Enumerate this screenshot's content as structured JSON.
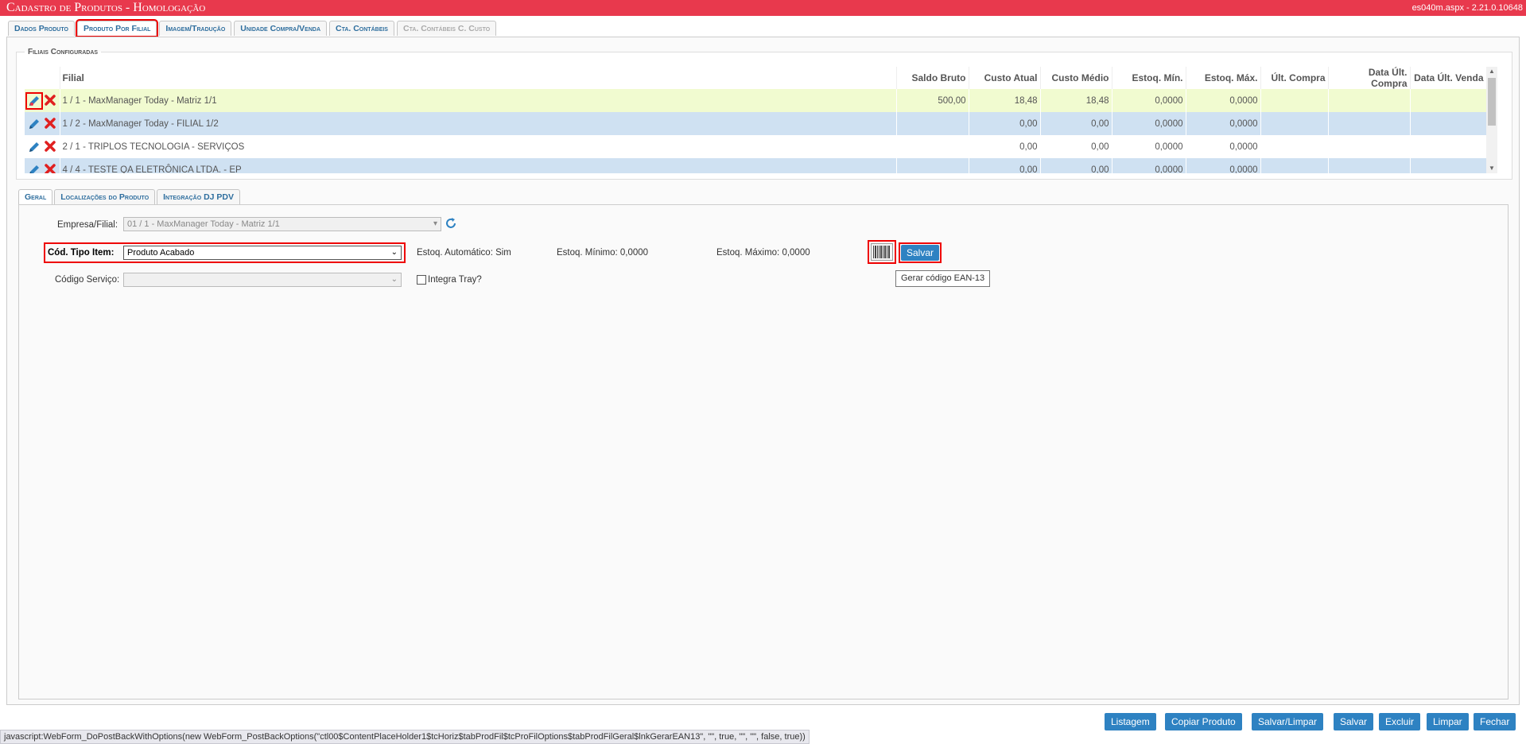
{
  "title": "Cadastro de Produtos  - Homologação",
  "version": "es040m.aspx - 2.21.0.10648",
  "main_tabs": [
    {
      "label": "Dados Produto"
    },
    {
      "label": "Produto Por Filial"
    },
    {
      "label": "Imagem/Tradução"
    },
    {
      "label": "Unidade Compra/Venda"
    },
    {
      "label": "Cta. Contábeis"
    },
    {
      "label": "Cta. Contábeis C. Custo"
    }
  ],
  "filiais": {
    "legend": "Filiais Configuradas",
    "columns": [
      "Filial",
      "Saldo Bruto",
      "Custo Atual",
      "Custo Médio",
      "Estoq. Mín.",
      "Estoq. Máx.",
      "Últ. Compra",
      "Data Últ. Compra",
      "Data Últ. Venda"
    ],
    "rows": [
      {
        "filial": "1 / 1 - MaxManager Today - Matriz 1/1",
        "saldo": "500,00",
        "custo_atual": "18,48",
        "custo_medio": "18,48",
        "min": "0,0000",
        "max": "0,0000",
        "ult_compra": "",
        "data_compra": "",
        "data_venda": ""
      },
      {
        "filial": "1 / 2 - MaxManager Today - FILIAL 1/2",
        "saldo": "",
        "custo_atual": "0,00",
        "custo_medio": "0,00",
        "min": "0,0000",
        "max": "0,0000",
        "ult_compra": "",
        "data_compra": "",
        "data_venda": ""
      },
      {
        "filial": "2 / 1 - TRIPLOS TECNOLOGIA - SERVIÇOS",
        "saldo": "",
        "custo_atual": "0,00",
        "custo_medio": "0,00",
        "min": "0,0000",
        "max": "0,0000",
        "ult_compra": "",
        "data_compra": "",
        "data_venda": ""
      },
      {
        "filial": "4 / 4 - TESTE QA ELETRÔNICA LTDA. - EP",
        "saldo": "",
        "custo_atual": "0,00",
        "custo_medio": "0,00",
        "min": "0,0000",
        "max": "0,0000",
        "ult_compra": "",
        "data_compra": "",
        "data_venda": ""
      }
    ]
  },
  "sub_tabs": [
    {
      "label": "Geral"
    },
    {
      "label": "Localizações do Produto"
    },
    {
      "label": "Integração DJ PDV"
    }
  ],
  "form": {
    "empresa_label": "Empresa/Filial:",
    "empresa_value": "01 / 1 - MaxManager Today - Matriz 1/1",
    "tipo_label": "Cód. Tipo Item:",
    "tipo_value": "Produto Acabado",
    "estoq_auto": "Estoq. Automático: Sim",
    "estoq_min": "Estoq. Mínimo: 0,0000",
    "estoq_max": "Estoq. Máximo: 0,0000",
    "salvar": "Salvar",
    "tooltip": "Gerar código EAN-13",
    "servico_label": "Código Serviço:",
    "servico_value": "",
    "tray_label": "Integra Tray?"
  },
  "footer_buttons": [
    "Listagem",
    "Copiar Produto",
    "Salvar/Limpar",
    "Salvar",
    "Excluir",
    "Limpar",
    "Fechar"
  ],
  "status_text": "javascript:WebForm_DoPostBackWithOptions(new WebForm_PostBackOptions(\"ctl00$ContentPlaceHolder1$tcHoriz$tabProdFil$tcProFilOptions$tabProdFilGeral$lnkGerarEAN13\", \"\", true, \"\", \"\", false, true))",
  "colors": {
    "title_bar": "#e8394d",
    "button": "#2e82c2",
    "highlight": "#e00000"
  }
}
